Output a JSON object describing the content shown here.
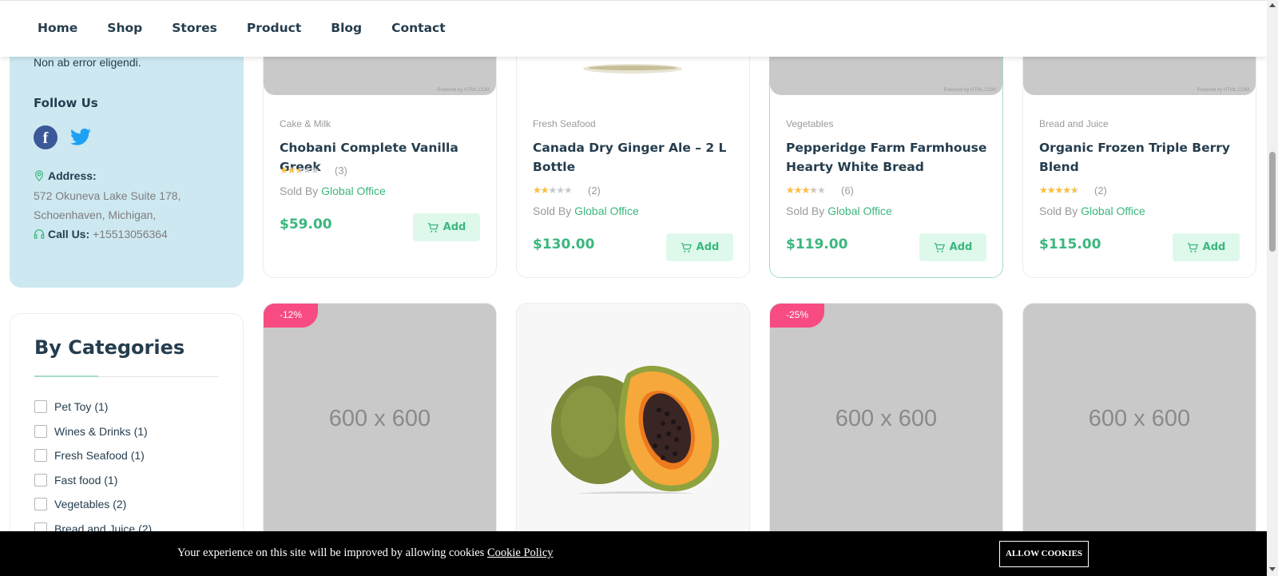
{
  "nav": {
    "items": [
      "Home",
      "Shop",
      "Stores",
      "Product",
      "Blog",
      "Contact"
    ]
  },
  "sidebar": {
    "contact_desc": "Non ab error eligendi.",
    "follow_title": "Follow Us",
    "address_label": "Address:",
    "address_line1": "572 Okuneva Lake Suite 178,",
    "address_line2": "Schoenhaven, Michigan,",
    "call_label": "Call Us:",
    "phone": "+15513056364",
    "categories_title": "By Categories",
    "categories": [
      "Pet Toy (1)",
      "Wines & Drinks (1)",
      "Fresh Seafood (1)",
      "Fast food (1)",
      "Vegetables (2)",
      "Bread and Juice (2)"
    ]
  },
  "products": [
    {
      "category": "Cake & Milk",
      "title": "Chobani Complete Vanilla Greek",
      "rating": 2.5,
      "reviews": "(3)",
      "sold_by_label": "Sold By",
      "seller": "Global Office",
      "price": "$59.00",
      "add_label": "Add",
      "image_credit": "Powered by HTML.COM"
    },
    {
      "category": "Fresh Seafood",
      "title": "Canada Dry Ginger Ale – 2 L Bottle",
      "rating": 2,
      "reviews": "(2)",
      "sold_by_label": "Sold By",
      "seller": "Global Office",
      "price": "$130.00",
      "add_label": "Add",
      "image_credit": ""
    },
    {
      "category": "Vegetables",
      "title": "Pepperidge Farm Farmhouse Hearty White Bread",
      "rating": 3,
      "reviews": "(6)",
      "sold_by_label": "Sold By",
      "seller": "Global Office",
      "price": "$119.00",
      "add_label": "Add",
      "image_credit": "Powered by HTML.COM"
    },
    {
      "category": "Bread and Juice",
      "title": "Organic Frozen Triple Berry Blend",
      "rating": 4,
      "reviews": "(2)",
      "sold_by_label": "Sold By",
      "seller": "Global Office",
      "price": "$115.00",
      "add_label": "Add",
      "image_credit": "Powered by HTML.COM"
    }
  ],
  "products_row2": [
    {
      "badge": "-12%",
      "placeholder": "600 x 600"
    },
    {
      "badge": "",
      "placeholder": ""
    },
    {
      "badge": "-25%",
      "placeholder": "600 x 600"
    },
    {
      "badge": "",
      "placeholder": "600 x 600"
    }
  ],
  "cookie": {
    "text": "Your experience on this site will be improved by allowing cookies",
    "link": "Cookie Policy",
    "button": "ALLOW COOKIES"
  },
  "colors": {
    "accent": "#3bb77e",
    "badge": "#f74b81",
    "sidebar_bg": "#cde8f1",
    "heading": "#253d4e"
  }
}
